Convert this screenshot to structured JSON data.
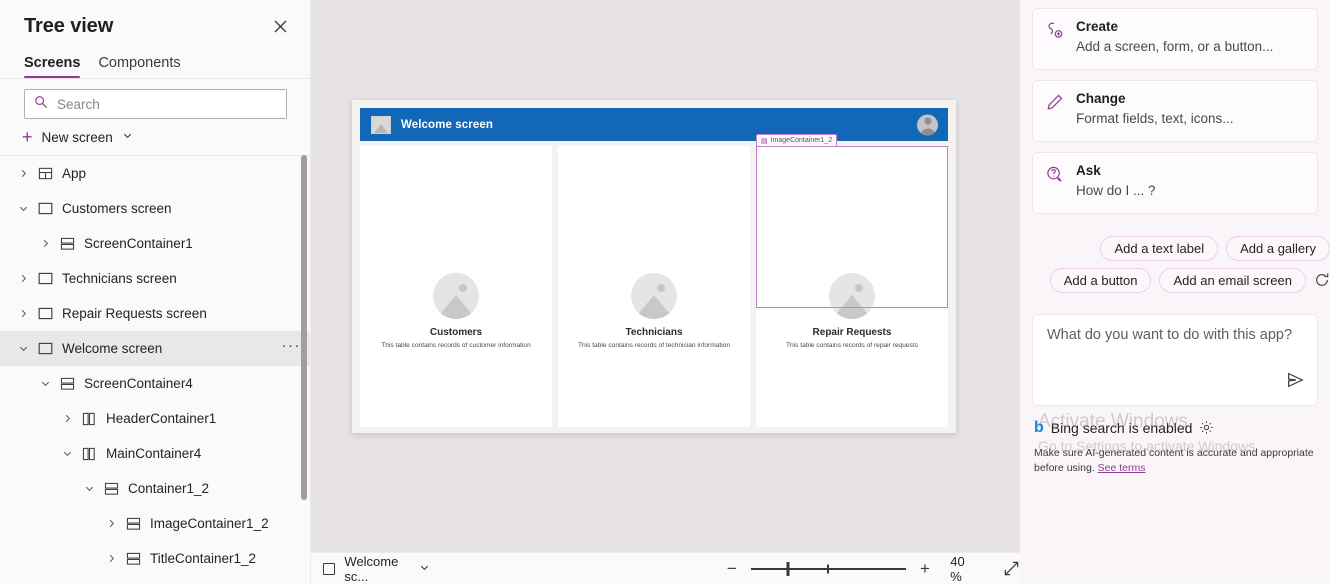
{
  "tree_panel": {
    "title": "Tree view",
    "close_icon": "close-icon",
    "tabs": [
      {
        "label": "Screens",
        "active": true
      },
      {
        "label": "Components",
        "active": false
      }
    ],
    "search": {
      "placeholder": "Search",
      "value": "",
      "icon": "search-icon"
    },
    "new_screen": {
      "label": "New screen",
      "plus_icon": "plus-icon",
      "chevron_icon": "chevron-down-icon"
    },
    "items": [
      {
        "label": "App",
        "icon": "app-icon",
        "twisty": "collapsed",
        "indent": 0,
        "selected": false,
        "menu": false
      },
      {
        "label": "Customers screen",
        "icon": "screen-icon",
        "twisty": "expanded",
        "indent": 0,
        "selected": false,
        "menu": false
      },
      {
        "label": "ScreenContainer1",
        "icon": "vertical-container-icon",
        "twisty": "collapsed",
        "indent": 1,
        "selected": false,
        "menu": false
      },
      {
        "label": "Technicians screen",
        "icon": "screen-icon",
        "twisty": "collapsed",
        "indent": 0,
        "selected": false,
        "menu": false
      },
      {
        "label": "Repair Requests screen",
        "icon": "screen-icon",
        "twisty": "collapsed",
        "indent": 0,
        "selected": false,
        "menu": false
      },
      {
        "label": "Welcome screen",
        "icon": "screen-icon",
        "twisty": "expanded",
        "indent": 0,
        "selected": true,
        "menu": true,
        "menu_label": "···"
      },
      {
        "label": "ScreenContainer4",
        "icon": "vertical-container-icon",
        "twisty": "expanded",
        "indent": 1,
        "selected": false,
        "menu": false
      },
      {
        "label": "HeaderContainer1",
        "icon": "horizontal-container-icon",
        "twisty": "collapsed",
        "indent": 2,
        "selected": false,
        "menu": false
      },
      {
        "label": "MainContainer4",
        "icon": "horizontal-container-icon",
        "twisty": "expanded",
        "indent": 2,
        "selected": false,
        "menu": false
      },
      {
        "label": "Container1_2",
        "icon": "vertical-container-icon",
        "twisty": "expanded",
        "indent": 3,
        "selected": false,
        "menu": false
      },
      {
        "label": "ImageContainer1_2",
        "icon": "vertical-container-icon",
        "twisty": "collapsed",
        "indent": 4,
        "selected": false,
        "menu": false
      },
      {
        "label": "TitleContainer1_2",
        "icon": "vertical-container-icon",
        "twisty": "collapsed",
        "indent": 4,
        "selected": false,
        "menu": false
      }
    ]
  },
  "canvas": {
    "app_header": {
      "title": "Welcome screen",
      "logo_icon": "image-placeholder-icon",
      "avatar_icon": "user-avatar-icon",
      "background": "#1267b8"
    },
    "selection": {
      "badge_label": "ImageContainer1_2",
      "badge_icon": "container-icon",
      "color": "#c182c6"
    },
    "cards": [
      {
        "title": "Customers",
        "desc": "This table contains records of customer information",
        "image_icon": "image-placeholder-icon",
        "selected": false
      },
      {
        "title": "Technicians",
        "desc": "This table contains records of technician information",
        "image_icon": "image-placeholder-icon",
        "selected": false
      },
      {
        "title": "Repair Requests",
        "desc": "This table contains records of repair requests",
        "image_icon": "image-placeholder-icon",
        "selected": true
      }
    ]
  },
  "bottom_bar": {
    "screen_selector": {
      "label": "Welcome sc...",
      "icon": "screen-icon",
      "chevron_icon": "chevron-down-icon"
    },
    "zoom_out_label": "−",
    "zoom_in_label": "+",
    "zoom_value": "40 %",
    "zoom_percent": 40,
    "fit_icon": "fit-to-screen-icon"
  },
  "copilot": {
    "suggestion_cards": [
      {
        "title": "Create",
        "subtitle": "Add a screen, form, or a button...",
        "icon": "create-icon"
      },
      {
        "title": "Change",
        "subtitle": "Format fields, text, icons...",
        "icon": "pencil-icon"
      },
      {
        "title": "Ask",
        "subtitle": "How do I ... ?",
        "icon": "question-bubble-icon"
      }
    ],
    "chips_row1": [
      "Add a text label",
      "Add a gallery"
    ],
    "chips_row2": [
      "Add a button",
      "Add an email screen"
    ],
    "refresh_icon": "refresh-icon",
    "prompt": {
      "placeholder": "What do you want to do with this app?",
      "value": "",
      "send_icon": "send-icon"
    },
    "bing": {
      "logo_icon": "bing-icon",
      "text": "Bing search is enabled",
      "gear_icon": "gear-icon"
    },
    "disclaimer": {
      "text": "Make sure AI-generated content is accurate and appropriate before using.",
      "link": "See terms"
    }
  },
  "watermark": {
    "line1": "Activate Windows",
    "line2": "Go to Settings to activate Windows."
  }
}
